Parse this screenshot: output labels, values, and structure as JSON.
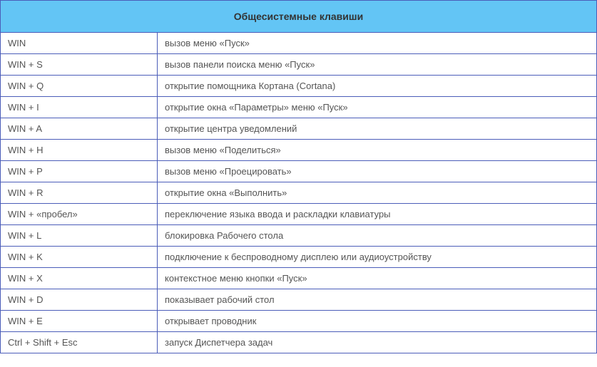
{
  "header": "Общесистемные клавиши",
  "rows": [
    {
      "key": "WIN",
      "desc": "вызов меню «Пуск»"
    },
    {
      "key": "WIN + S",
      "desc": "вызов панели поиска меню «Пуск»"
    },
    {
      "key": "WIN + Q",
      "desc": "открытие помощника Кортана (Cortana)"
    },
    {
      "key": "WIN + I",
      "desc": "открытие окна «Параметры» меню «Пуск»"
    },
    {
      "key": "WIN + A",
      "desc": "открытие центра уведомлений"
    },
    {
      "key": "WIN + H",
      "desc": "вызов меню «Поделиться»"
    },
    {
      "key": "WIN + P",
      "desc": "вызов меню «Проецировать»"
    },
    {
      "key": "WIN + R",
      "desc": "открытие окна «Выполнить»"
    },
    {
      "key": "WIN + «пробел»",
      "desc": "переключение языка ввода и раскладки клавиатуры"
    },
    {
      "key": "WIN + L",
      "desc": "блокировка Рабочего стола"
    },
    {
      "key": "WIN + K",
      "desc": "подключение к беспроводному дисплею или аудиоустройству"
    },
    {
      "key": "WIN + X",
      "desc": "контекстное меню кнопки «Пуск»"
    },
    {
      "key": "WIN + D",
      "desc": "показывает рабочий стол"
    },
    {
      "key": "WIN + E",
      "desc": "открывает проводник"
    },
    {
      "key": "Ctrl + Shift + Esc",
      "desc": "запуск Диспетчера задач"
    }
  ]
}
